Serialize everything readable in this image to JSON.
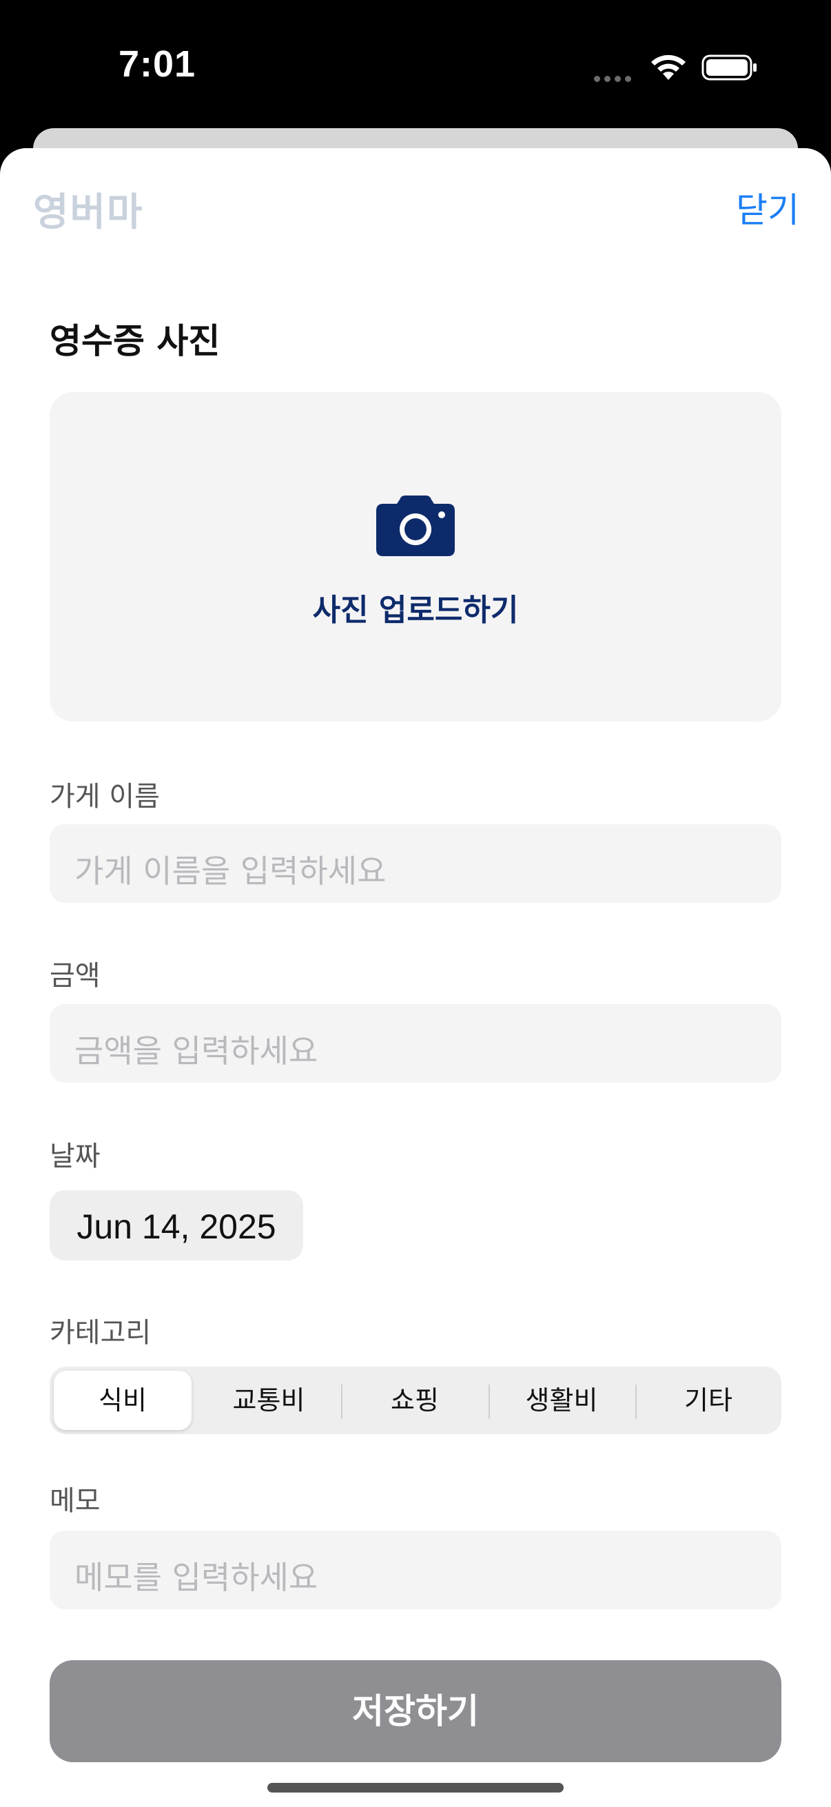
{
  "status_bar": {
    "time": "7:01"
  },
  "nav": {
    "logo": "영버마",
    "close_label": "닫기"
  },
  "receipt": {
    "section_title": "영수증 사진",
    "upload_label": "사진 업로드하기",
    "upload_icon": "camera-icon"
  },
  "store": {
    "label": "가게 이름",
    "placeholder": "가게 이름을 입력하세요"
  },
  "amount": {
    "label": "금액",
    "placeholder": "금액을 입력하세요"
  },
  "date": {
    "label": "날짜",
    "value": "Jun 14, 2025"
  },
  "category": {
    "label": "카테고리",
    "options": [
      "식비",
      "교통비",
      "쇼핑",
      "생활비",
      "기타"
    ],
    "selected": "식비"
  },
  "memo": {
    "label": "메모",
    "placeholder": "메모를 입력하세요"
  },
  "save_label": "저장하기",
  "colors": {
    "accent": "#1a7ef5",
    "brand_navy": "#0d2b6b",
    "button_disabled": "#8e8e93",
    "field_bg": "#f4f4f5"
  }
}
